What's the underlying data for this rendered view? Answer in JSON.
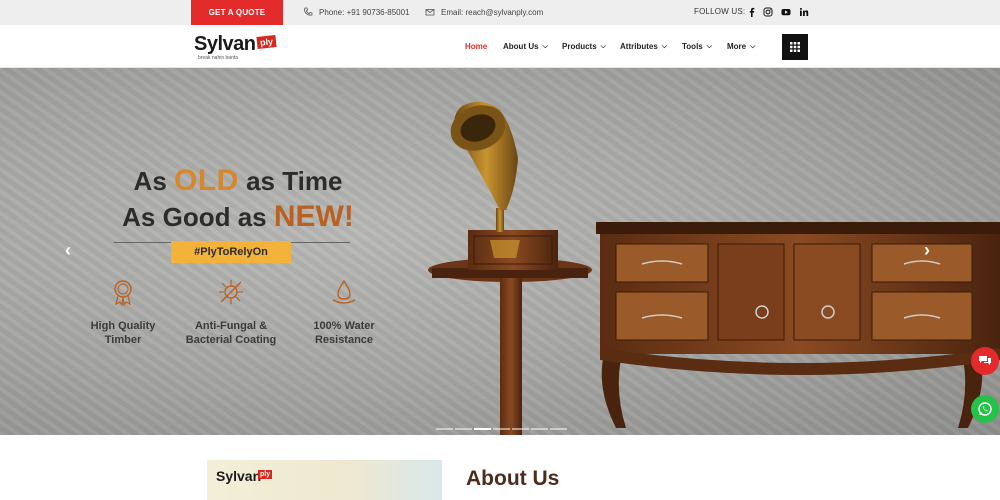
{
  "topbar": {
    "quote_label": "GET A QUOTE",
    "phone": "Phone: +91 90736-85001",
    "email": "Email: reach@sylvanply.com",
    "follow_label": "FOLLOW US:",
    "socials": [
      "facebook-icon",
      "instagram-icon",
      "youtube-icon",
      "linkedin-icon"
    ]
  },
  "header": {
    "logo_word": "Sylvan",
    "logo_ply": "ply",
    "logo_tag": "break nahin banta",
    "nav": [
      {
        "label": "Home",
        "active": true
      },
      {
        "label": "About Us"
      },
      {
        "label": "Products"
      },
      {
        "label": "Attributes"
      },
      {
        "label": "Tools"
      },
      {
        "label": "More"
      }
    ]
  },
  "hero": {
    "line1_a": "As ",
    "line1_b": "OLD",
    "line1_c": " as Time",
    "line2_a": "As Good as ",
    "line2_b": "NEW!",
    "hashtag": "#PlyToRelyOn",
    "features": [
      {
        "l1": "High Quality",
        "l2": "Timber"
      },
      {
        "l1": "Anti-Fungal &",
        "l2": "Bacterial Coating"
      },
      {
        "l1": "100% Water",
        "l2": "Resistance"
      }
    ],
    "slide_count": 7,
    "active_slide": 3
  },
  "about": {
    "title": "About Us",
    "logo_word": "Sylvan",
    "logo_ply": "ply"
  },
  "colors": {
    "accent": "#e32b2b",
    "brand_brown": "#4e2c1c",
    "hashtag_bg": "#f3b23a",
    "chat_red": "#e32b2b",
    "whatsapp_green": "#25c24a"
  }
}
